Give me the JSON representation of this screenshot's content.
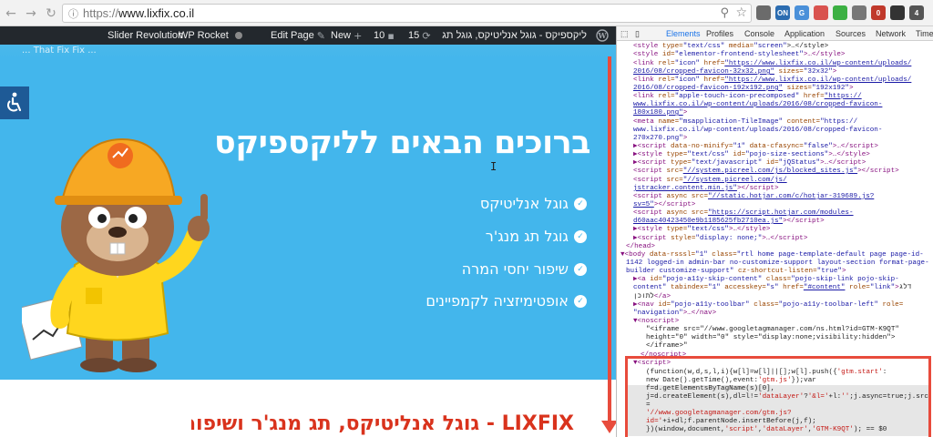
{
  "browser": {
    "url_protocol": "https://",
    "url_host": "www.lixfix.co.il",
    "extensions": [
      {
        "name": "extension-1-icon",
        "color": "#6b6b6b",
        "label": ""
      },
      {
        "name": "extension-2-icon",
        "color": "#2b6cb0",
        "label": "ON"
      },
      {
        "name": "extension-3-icon",
        "color": "#4a90d9",
        "label": "G"
      },
      {
        "name": "extension-4-icon",
        "color": "#d9534f",
        "label": ""
      },
      {
        "name": "extension-5-icon",
        "color": "#3cb043",
        "label": ""
      },
      {
        "name": "extension-6-icon",
        "color": "#777777",
        "label": ""
      },
      {
        "name": "extension-7-icon",
        "color": "#c0392b",
        "label": "0"
      },
      {
        "name": "extension-8-icon",
        "color": "#333333",
        "label": ""
      },
      {
        "name": "extension-9-icon",
        "color": "#555555",
        "label": "4"
      }
    ]
  },
  "admin_bar": {
    "site_name": "ליקספיקס - גוגל אנליטיקס, גוגל תג מנג...",
    "updates_count": "15",
    "comments_count": "10",
    "new_label": "New",
    "edit_label": "Edit Page",
    "wp_rocket": "WP Rocket",
    "slider_revolution": "Slider Revolution"
  },
  "page": {
    "hero_title": "ברוכים הבאים לליקספיקס",
    "features": [
      "גוגל אנליטיקס",
      "גוגל תג מנג'ר",
      "שיפור יחסי המרה",
      "אופטימיזציה לקמפיינים"
    ],
    "below_heading": "LIXFIX - גוגל אנליטיקס, תג מנג'ר ושיפור יחסי המרה",
    "top_faded": "... That Fix Fix ..."
  },
  "devtools": {
    "tabs": [
      "Elements",
      "Profiles",
      "Console",
      "Application",
      "Sources",
      "Network",
      "Timel"
    ],
    "selected_tab": "Elements"
  },
  "colors": {
    "hero_blue": "#43b6ec",
    "admin_bar": "#23282d",
    "accent_red": "#e84b3c"
  }
}
